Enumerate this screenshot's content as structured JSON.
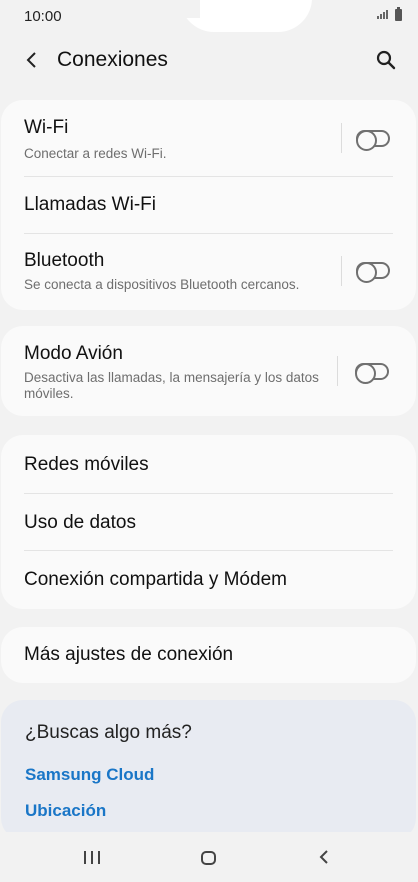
{
  "status_bar": {
    "time": "10:00"
  },
  "header": {
    "title": "Conexiones"
  },
  "groups": [
    {
      "items": [
        {
          "label": "Wi-Fi",
          "subtitle": "Conectar a redes Wi-Fi.",
          "toggle": "off"
        },
        {
          "label": "Llamadas Wi-Fi"
        },
        {
          "label": "Bluetooth",
          "subtitle": "Se conecta a dispositivos Bluetooth cercanos.",
          "toggle": "off"
        }
      ]
    },
    {
      "items": [
        {
          "label": "Modo Avión",
          "subtitle": "Desactiva las llamadas, la mensajería y los datos móviles.",
          "toggle": "off"
        }
      ]
    },
    {
      "items": [
        {
          "label": "Redes móviles"
        },
        {
          "label": "Uso de datos"
        },
        {
          "label": "Conexión compartida y Módem"
        }
      ]
    },
    {
      "items": [
        {
          "label": "Más ajustes de conexión"
        }
      ]
    }
  ],
  "suggestions": {
    "title": "¿Buscas algo más?",
    "links": [
      "Samsung Cloud",
      "Ubicación"
    ]
  },
  "colors": {
    "link": "#1a76c7",
    "background": "#f2f2f2",
    "card": "#fafafa"
  }
}
